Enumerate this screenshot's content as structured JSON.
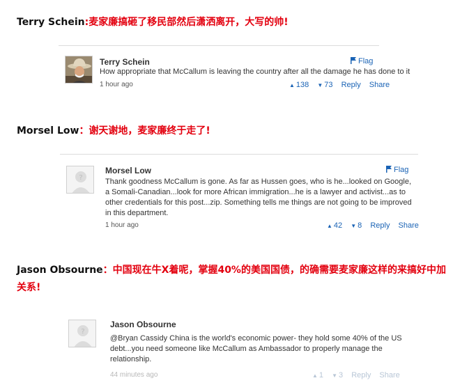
{
  "sections": [
    {
      "heading_name": "Terry Schein",
      "heading_sep": ":",
      "heading_text": "麦家廉搞砸了移民部然后潇洒离开，大写的帅!",
      "author": "Terry Schein",
      "body": "How appropriate that McCallum is leaving the country after all the damage he has done to it",
      "time": "1 hour ago",
      "flag": "Flag",
      "upvotes": "138",
      "downvotes": "73",
      "reply": "Reply",
      "share": "Share",
      "avatar_icon": "cowboy-avatar-photo"
    },
    {
      "heading_name": "Morsel Low",
      "heading_sep": "：",
      "heading_text": "谢天谢地，麦家廉终于走了!",
      "author": "Morsel Low",
      "body": "Thank goodness McCallum is gone. As far as Hussen goes, who is he...looked on Google, a Somali-Canadian...look for more African immigration...he is a lawyer and activist...as to other credentials for this post...zip. Something tells me things are not going to be improved in this department.",
      "time": "1 hour ago",
      "flag": "Flag",
      "upvotes": "42",
      "downvotes": "8",
      "reply": "Reply",
      "share": "Share",
      "avatar_icon": "default-avatar-question"
    },
    {
      "heading_name": "Jason Obsourne",
      "heading_sep": "：",
      "heading_text": "中国现在牛X着呢，掌握40%的美国国债，的确需要麦家廉这样的来搞好中加关系!",
      "author": "Jason Obsourne",
      "body": "@Bryan Cassidy China is the world's economic power- they hold some 40% of the US debt...you need someone like McCallum as Ambassador to properly manage the relationship.",
      "time": "44 minutes ago",
      "upvotes": "1",
      "downvotes": "3",
      "reply": "Reply",
      "share": "Share",
      "avatar_icon": "default-avatar-question"
    }
  ],
  "colors": {
    "heading_highlight": "#e3000f",
    "link": "#1a63b5"
  }
}
